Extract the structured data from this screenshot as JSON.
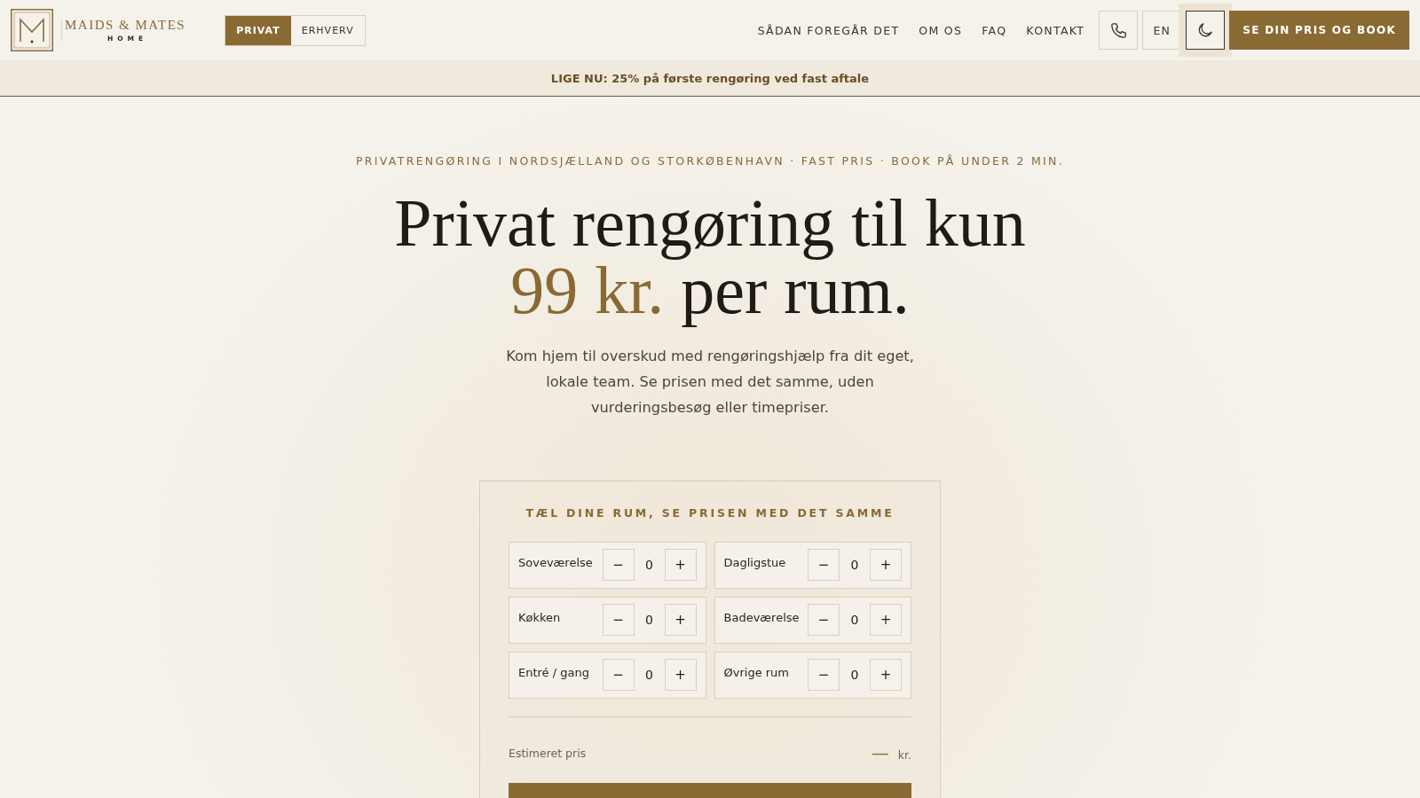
{
  "header": {
    "logo": {
      "name": "MAIDS & MATES",
      "tagline": "HOME"
    },
    "segments": [
      {
        "label": "PRIVAT",
        "selected": true
      },
      {
        "label": "ERHVERV",
        "selected": false
      }
    ],
    "nav": [
      "SÅDAN FOREGÅR DET",
      "OM OS",
      "FAQ",
      "KONTAKT"
    ],
    "tools": [
      {
        "kind": "phone",
        "focused": false
      },
      {
        "kind": "language",
        "label": "EN",
        "focused": false
      },
      {
        "kind": "theme",
        "focused": true
      }
    ],
    "cta": "SE DIN PRIS OG BOOK"
  },
  "banner": "LIGE NU: 25% på første rengøring ved fast aftale",
  "hero": {
    "eyebrow": "PRIVATRENGØRING I NORDSJÆLLAND OG STORKØBENHAVN · FAST PRIS · BOOK PÅ UNDER 2 MIN.",
    "title": {
      "text": "Privat rengøring til kun",
      "accent": "99 kr.",
      "after": "per rum."
    },
    "subtitle": "Kom hjem til overskud med rengøringshjælp fra dit eget, lokale team. Se prisen med det samme, uden vurderingsbesøg eller timepriser."
  },
  "calculator": {
    "title": "TÆL DINE RUM, SE PRISEN MED DET SAMME",
    "rooms": [
      {
        "label": "Soveværelse",
        "minus": "−",
        "value": "0",
        "plus": "+"
      },
      {
        "label": "Dagligstue",
        "minus": "−",
        "value": "0",
        "plus": "+"
      },
      {
        "label": "Køkken",
        "minus": "−",
        "value": "0",
        "plus": "+"
      },
      {
        "label": "Badeværelse",
        "minus": "−",
        "value": "0",
        "plus": "+"
      },
      {
        "label": "Entré / gang",
        "minus": "−",
        "value": "0",
        "plus": "+"
      },
      {
        "label": "Øvrige rum",
        "minus": "−",
        "value": "0",
        "plus": "+"
      }
    ],
    "price": {
      "label": "Estimeret pris",
      "value": "—",
      "unit": "kr."
    }
  }
}
